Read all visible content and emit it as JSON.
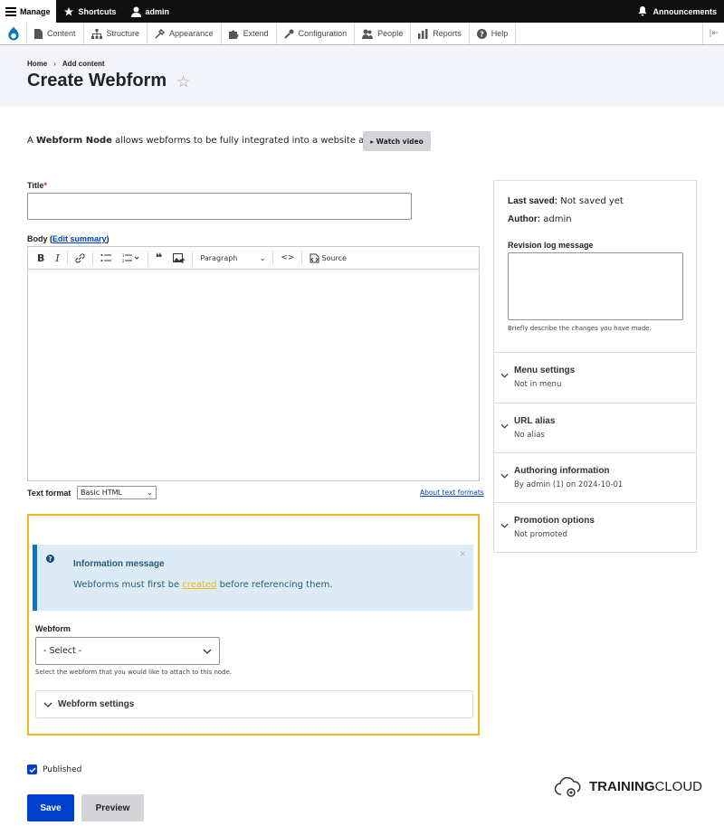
{
  "toolbar": {
    "manage": "Manage",
    "shortcuts": "Shortcuts",
    "user": "admin",
    "announcements": "Announcements"
  },
  "menu": {
    "items": [
      "Content",
      "Structure",
      "Appearance",
      "Extend",
      "Configuration",
      "People",
      "Reports",
      "Help"
    ]
  },
  "breadcrumb": {
    "home": "Home",
    "sep": "›",
    "current": "Add content"
  },
  "page": {
    "title": "Create Webform",
    "star": "☆",
    "intro_prefix": "A ",
    "intro_bold": "Webform Node",
    "intro_suffix": " allows webforms to be fully integrated into a website as nodes.",
    "watch_video": "▸ Watch video"
  },
  "form": {
    "title_label": "Title",
    "required_mark": "*",
    "body_label": "Body (",
    "edit_summary": "Edit summary",
    "body_label_end": ")",
    "editor_paragraph": "Paragraph",
    "editor_source": "Source",
    "text_format_label": "Text format",
    "text_format_value": "Basic HTML",
    "about_text_formats": "About text formats"
  },
  "webform": {
    "message_title": "Information message",
    "message_prefix": "Webforms must first be ",
    "message_link": "created",
    "message_suffix": " before referencing them.",
    "close": "×",
    "label": "Webform",
    "select_value": "- Select -",
    "description": "Select the webform that you would like to attach to this node.",
    "settings_label": "Webform settings"
  },
  "sidebar": {
    "last_saved_label": "Last saved:",
    "last_saved_value": " Not saved yet",
    "author_label": "Author:",
    "author_value": " admin",
    "revision_label": "Revision log message",
    "revision_desc": "Briefly describe the changes you have made.",
    "sections": [
      {
        "title": "Menu settings",
        "summary": "Not in menu"
      },
      {
        "title": "URL alias",
        "summary": "No alias"
      },
      {
        "title": "Authoring information",
        "summary": "By admin (1) on 2024-10-01"
      },
      {
        "title": "Promotion options",
        "summary": "Not promoted"
      }
    ]
  },
  "actions": {
    "published": "Published",
    "save": "Save",
    "preview": "Preview"
  },
  "brand": {
    "part1": "TRAINING",
    "part2": "CLOUD"
  },
  "colors": {
    "accent": "#003ecc",
    "highlight": "#f0b917",
    "info": "#0f75bc"
  }
}
